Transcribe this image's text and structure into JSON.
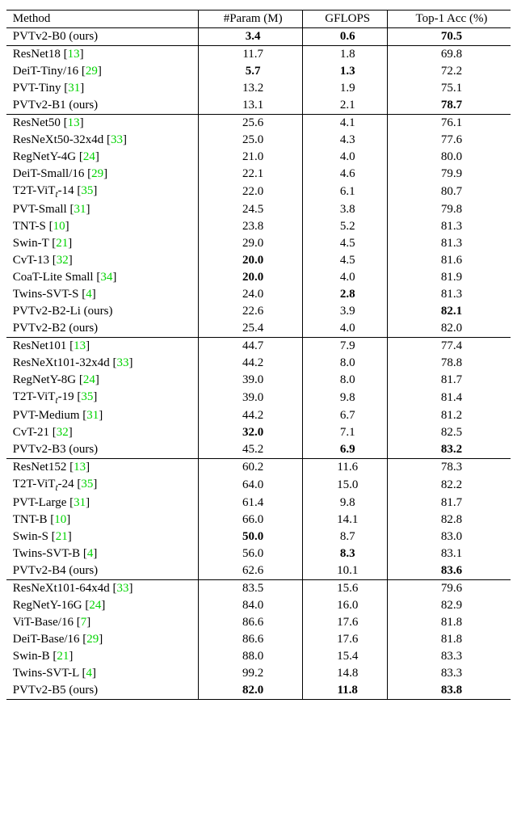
{
  "headers": {
    "method": "Method",
    "param": "#Param (M)",
    "gflops": "GFLOPS",
    "acc": "Top-1 Acc (%)"
  },
  "groups": [
    {
      "rows": [
        {
          "name": "PVTv2-B0 (ours)",
          "cite": "",
          "param": "3.4",
          "param_b": true,
          "gflops": "0.6",
          "gflops_b": true,
          "acc": "70.5",
          "acc_b": true
        }
      ]
    },
    {
      "rows": [
        {
          "name": "ResNet18",
          "cite": "13",
          "param": "11.7",
          "gflops": "1.8",
          "acc": "69.8"
        },
        {
          "name": "DeiT-Tiny/16",
          "cite": "29",
          "param": "5.7",
          "param_b": true,
          "gflops": "1.3",
          "gflops_b": true,
          "acc": "72.2"
        },
        {
          "name": "PVT-Tiny",
          "cite": "31",
          "param": "13.2",
          "gflops": "1.9",
          "acc": "75.1"
        },
        {
          "name": "PVTv2-B1 (ours)",
          "cite": "",
          "param": "13.1",
          "gflops": "2.1",
          "acc": "78.7",
          "acc_b": true
        }
      ]
    },
    {
      "rows": [
        {
          "name": "ResNet50",
          "cite": "13",
          "param": "25.6",
          "gflops": "4.1",
          "acc": "76.1"
        },
        {
          "name": "ResNeXt50-32x4d",
          "cite": "33",
          "param": "25.0",
          "gflops": "4.3",
          "acc": "77.6"
        },
        {
          "name": "RegNetY-4G",
          "cite": "24",
          "param": "21.0",
          "gflops": "4.0",
          "acc": "80.0"
        },
        {
          "name": "DeiT-Small/16",
          "cite": "29",
          "param": "22.1",
          "gflops": "4.6",
          "acc": "79.9"
        },
        {
          "name": "T2T-ViT<sub>t</sub>-14",
          "sub": true,
          "cite": "35",
          "param": "22.0",
          "gflops": "6.1",
          "acc": "80.7"
        },
        {
          "name": "PVT-Small",
          "cite": "31",
          "param": "24.5",
          "gflops": "3.8",
          "acc": "79.8"
        },
        {
          "name": "TNT-S",
          "cite": "10",
          "param": "23.8",
          "gflops": "5.2",
          "acc": "81.3"
        },
        {
          "name": "Swin-T",
          "cite": "21",
          "param": "29.0",
          "gflops": "4.5",
          "acc": "81.3"
        },
        {
          "name": "CvT-13",
          "cite": "32",
          "param": "20.0",
          "param_b": true,
          "gflops": "4.5",
          "acc": "81.6"
        },
        {
          "name": "CoaT-Lite Small",
          "cite": "34",
          "param": "20.0",
          "param_b": true,
          "gflops": "4.0",
          "acc": "81.9"
        },
        {
          "name": "Twins-SVT-S",
          "cite": "4",
          "param": "24.0",
          "gflops": "2.8",
          "gflops_b": true,
          "acc": "81.3"
        },
        {
          "name": "PVTv2-B2-Li (ours)",
          "cite": "",
          "param": "22.6",
          "gflops": "3.9",
          "acc": "82.1",
          "acc_b": true
        },
        {
          "name": "PVTv2-B2 (ours)",
          "cite": "",
          "param": "25.4",
          "gflops": "4.0",
          "acc": "82.0"
        }
      ]
    },
    {
      "rows": [
        {
          "name": "ResNet101",
          "cite": "13",
          "param": "44.7",
          "gflops": "7.9",
          "acc": "77.4"
        },
        {
          "name": "ResNeXt101-32x4d",
          "cite": "33",
          "param": "44.2",
          "gflops": "8.0",
          "acc": "78.8"
        },
        {
          "name": "RegNetY-8G",
          "cite": "24",
          "param": "39.0",
          "gflops": "8.0",
          "acc": "81.7"
        },
        {
          "name": "T2T-ViT<sub>t</sub>-19",
          "sub": true,
          "cite": "35",
          "param": "39.0",
          "gflops": "9.8",
          "acc": "81.4"
        },
        {
          "name": "PVT-Medium",
          "cite": "31",
          "param": "44.2",
          "gflops": "6.7",
          "acc": "81.2"
        },
        {
          "name": "CvT-21",
          "cite": "32",
          "param": "32.0",
          "param_b": true,
          "gflops": "7.1",
          "acc": "82.5"
        },
        {
          "name": "PVTv2-B3 (ours)",
          "cite": "",
          "param": "45.2",
          "gflops": "6.9",
          "gflops_b": true,
          "acc": "83.2",
          "acc_b": true
        }
      ]
    },
    {
      "rows": [
        {
          "name": "ResNet152",
          "cite": "13",
          "param": "60.2",
          "gflops": "11.6",
          "acc": "78.3"
        },
        {
          "name": "T2T-ViT<sub>t</sub>-24",
          "sub": true,
          "cite": "35",
          "param": "64.0",
          "gflops": "15.0",
          "acc": "82.2"
        },
        {
          "name": "PVT-Large ",
          "cite": "31",
          "param": "61.4",
          "gflops": "9.8",
          "acc": "81.7"
        },
        {
          "name": "TNT-B ",
          "cite": "10",
          "param": "66.0",
          "gflops": "14.1",
          "acc": "82.8"
        },
        {
          "name": "Swin-S ",
          "cite": "21",
          "param": "50.0",
          "param_b": true,
          "gflops": "8.7",
          "acc": "83.0"
        },
        {
          "name": "Twins-SVT-B",
          "cite": "4",
          "param": "56.0",
          "gflops": "8.3",
          "gflops_b": true,
          "acc": "83.1"
        },
        {
          "name": "PVTv2-B4 (ours)",
          "cite": "",
          "param": "62.6",
          "gflops": "10.1",
          "acc": "83.6",
          "acc_b": true
        }
      ]
    },
    {
      "rows": [
        {
          "name": "ResNeXt101-64x4d",
          "cite": "33",
          "param": "83.5",
          "gflops": "15.6",
          "acc": "79.6"
        },
        {
          "name": "RegNetY-16G",
          "cite": "24",
          "param": "84.0",
          "gflops": "16.0",
          "acc": "82.9"
        },
        {
          "name": "ViT-Base/16",
          "cite": "7",
          "param": "86.6",
          "gflops": "17.6",
          "acc": "81.8"
        },
        {
          "name": "DeiT-Base/16",
          "cite": "29",
          "param": "86.6",
          "gflops": "17.6",
          "acc": "81.8"
        },
        {
          "name": "Swin-B",
          "cite": "21",
          "param": "88.0",
          "gflops": "15.4",
          "acc": "83.3"
        },
        {
          "name": "Twins-SVT-L",
          "cite": "4",
          "param": "99.2",
          "gflops": "14.8",
          "acc": "83.3"
        },
        {
          "name": "PVTv2-B5 (ours)",
          "cite": "",
          "param": "82.0",
          "param_b": true,
          "gflops": "11.8",
          "gflops_b": true,
          "acc": "83.8",
          "acc_b": true
        }
      ]
    }
  ]
}
